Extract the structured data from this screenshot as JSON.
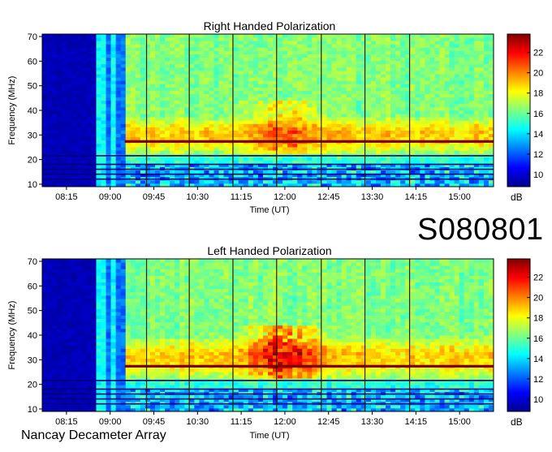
{
  "station_id": "S080801",
  "observatory": "Nancay Decameter Array",
  "chart_data": [
    {
      "type": "heatmap",
      "title": "Right Handed Polarization",
      "xlabel": "Time (UT)",
      "ylabel": "Frequency (MHz)",
      "x_ticks": [
        "08:15",
        "09:00",
        "09:45",
        "10:30",
        "11:15",
        "12:00",
        "12:45",
        "13:30",
        "14:15",
        "15:00"
      ],
      "y_ticks": [
        10,
        20,
        30,
        40,
        50,
        60,
        70
      ],
      "ylim": [
        9,
        71
      ],
      "colorbar": {
        "label": "dB",
        "ticks": [
          10,
          12,
          14,
          16,
          18,
          20,
          22
        ],
        "range": [
          8.8,
          23.8
        ]
      },
      "features": {
        "receiver_off_until": "08:47",
        "band_edges_mhz": [
          12,
          14,
          16,
          18,
          21.5
        ],
        "strong_band_mhz": 27.3,
        "enhanced_range_mhz": [
          22,
          38
        ],
        "burst_center_time": "12:00"
      }
    },
    {
      "type": "heatmap",
      "title": "Left Handed Polarization",
      "xlabel": "Time (UT)",
      "ylabel": "Frequency (MHz)",
      "x_ticks": [
        "08:15",
        "09:00",
        "09:45",
        "10:30",
        "11:15",
        "12:00",
        "12:45",
        "13:30",
        "14:15",
        "15:00"
      ],
      "y_ticks": [
        10,
        20,
        30,
        40,
        50,
        60,
        70
      ],
      "ylim": [
        9,
        71
      ],
      "colorbar": {
        "label": "dB",
        "ticks": [
          10,
          12,
          14,
          16,
          18,
          20,
          22
        ],
        "range": [
          8.8,
          23.8
        ]
      },
      "features": {
        "receiver_off_until": "08:47",
        "band_edges_mhz": [
          12,
          14,
          16,
          18,
          21.5
        ],
        "strong_band_mhz": 27.3,
        "enhanced_range_mhz": [
          22,
          40
        ],
        "burst_center_time": "12:00"
      }
    }
  ]
}
